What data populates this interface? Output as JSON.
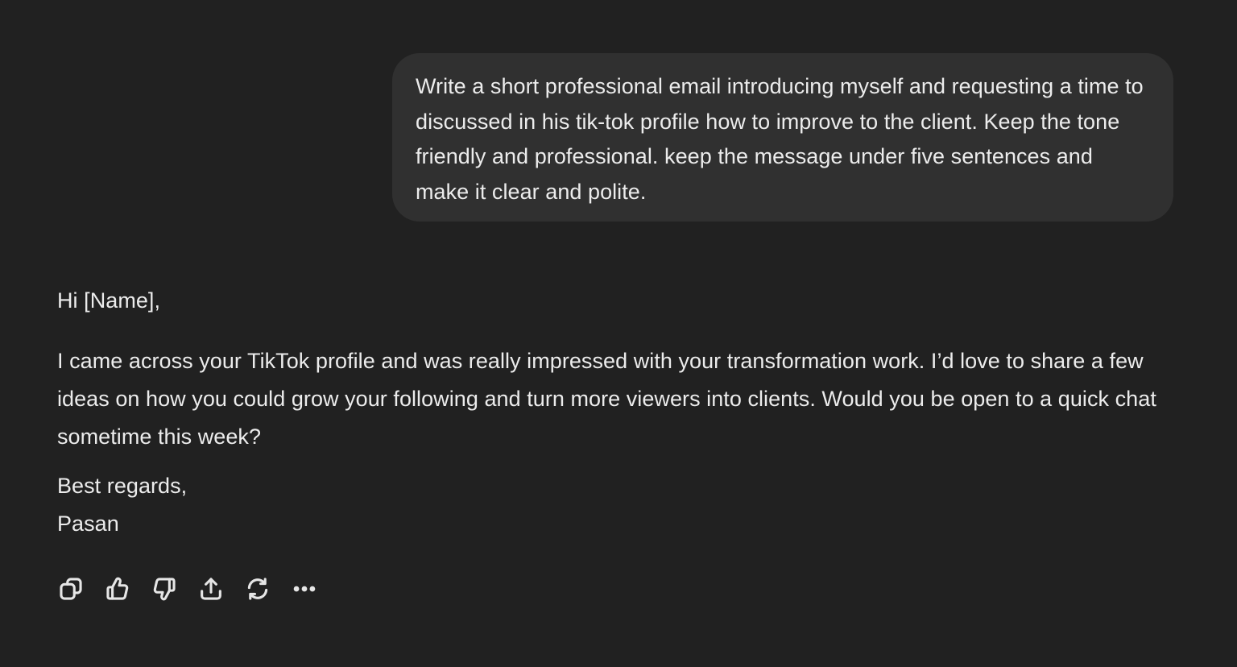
{
  "user_message": {
    "text": "Write a short professional email introducing myself and requesting a time to discussed in his tik-tok profile how to improve to the client. Keep the tone friendly and professional. keep the message under five sentences and make it clear and polite."
  },
  "assistant_message": {
    "greeting": "Hi [Name],",
    "body": "I came across your TikTok profile and was really impressed with your transformation work. I’d love to share a few ideas on how you could grow your following and turn more viewers into clients. Would you be open to a quick chat sometime this week?",
    "closing": "Best regards,",
    "signature": "Pasan"
  },
  "actions": [
    {
      "name": "copy-button",
      "icon": "copy-icon"
    },
    {
      "name": "thumbs-up-button",
      "icon": "thumbs-up-icon"
    },
    {
      "name": "thumbs-down-button",
      "icon": "thumbs-down-icon"
    },
    {
      "name": "share-button",
      "icon": "share-icon"
    },
    {
      "name": "regenerate-button",
      "icon": "regenerate-icon"
    },
    {
      "name": "more-options-button",
      "icon": "more-icon"
    }
  ],
  "colors": {
    "background": "#212121",
    "user_bubble": "#303030",
    "text": "#ececec"
  }
}
